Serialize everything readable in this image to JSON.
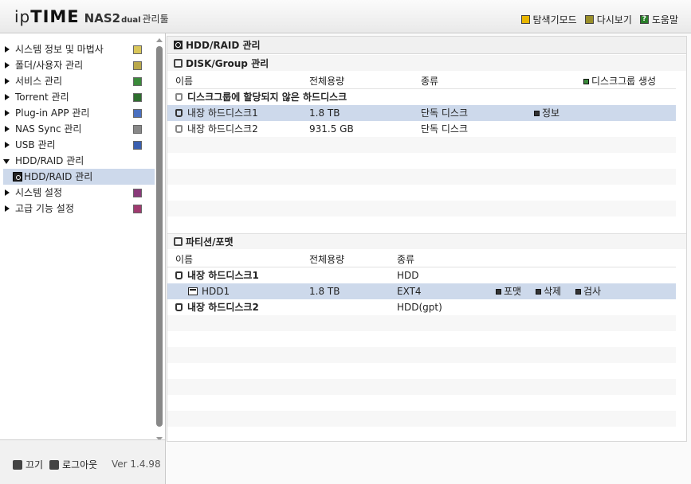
{
  "header": {
    "logo_ip": "ip",
    "logo_time": "TIME",
    "logo_model": "NAS2",
    "logo_dual": "dual",
    "logo_tool": "관리툴",
    "links": [
      {
        "label": "탐색기모드",
        "icon": "folder-icon"
      },
      {
        "label": "다시보기",
        "icon": "refresh-icon"
      },
      {
        "label": "도움말",
        "icon": "help-icon"
      }
    ]
  },
  "sidebar": {
    "items": [
      {
        "label": "시스템 정보 및 마법사",
        "icon": "chart-icon",
        "icon_color": "#d9c65a"
      },
      {
        "label": "폴더/사용자 관리",
        "icon": "folder-user-icon",
        "icon_color": "#b9a84a"
      },
      {
        "label": "서비스 관리",
        "icon": "service-icon",
        "icon_color": "#3a8a3a"
      },
      {
        "label": "Torrent 관리",
        "icon": "torrent-icon",
        "icon_color": "#2e6e2e"
      },
      {
        "label": "Plug-in APP 관리",
        "icon": "plugin-icon",
        "icon_color": "#4a70c0"
      },
      {
        "label": "NAS Sync 관리",
        "icon": "sync-icon",
        "icon_color": "#888888"
      },
      {
        "label": "USB 관리",
        "icon": "usb-icon",
        "icon_color": "#3a5fb0"
      },
      {
        "label": "HDD/RAID 관리",
        "icon": "",
        "open": true
      },
      {
        "label": "시스템 설정",
        "icon": "system-settings-icon",
        "icon_color": "#8a3a7a"
      },
      {
        "label": "고급 기능 설정",
        "icon": "advanced-settings-icon",
        "icon_color": "#a03a70"
      }
    ],
    "sub_item": "HDD/RAID 관리",
    "footer": {
      "power_label": "끄기",
      "logout_label": "로그아웃",
      "version": "Ver 1.4.98"
    }
  },
  "main": {
    "title": "HDD/RAID 관리",
    "disk_section": {
      "title": "DISK/Group 관리",
      "columns": [
        "이름",
        "전체용량",
        "종류"
      ],
      "create_group_label": "디스크그룹 생성",
      "unassigned_label": "디스크그룹에 할당되지 않은 하드디스크",
      "rows": [
        {
          "name": "내장 하드디스크1",
          "capacity": "1.8 TB",
          "type": "단독 디스크",
          "action": "정보"
        },
        {
          "name": "내장 하드디스크2",
          "capacity": "931.5 GB",
          "type": "단독 디스크",
          "action": ""
        }
      ]
    },
    "partition_section": {
      "title": "파티션/포맷",
      "columns": [
        "이름",
        "전체용량",
        "종류"
      ],
      "rows": [
        {
          "name": "내장 하드디스크1",
          "capacity": "",
          "type": "HDD"
        },
        {
          "name": "HDD1",
          "capacity": "1.8 TB",
          "type": "EXT4",
          "actions": [
            "포맷",
            "삭제",
            "검사"
          ]
        },
        {
          "name": "내장 하드디스크2",
          "capacity": "",
          "type": "HDD(gpt)"
        }
      ]
    }
  }
}
